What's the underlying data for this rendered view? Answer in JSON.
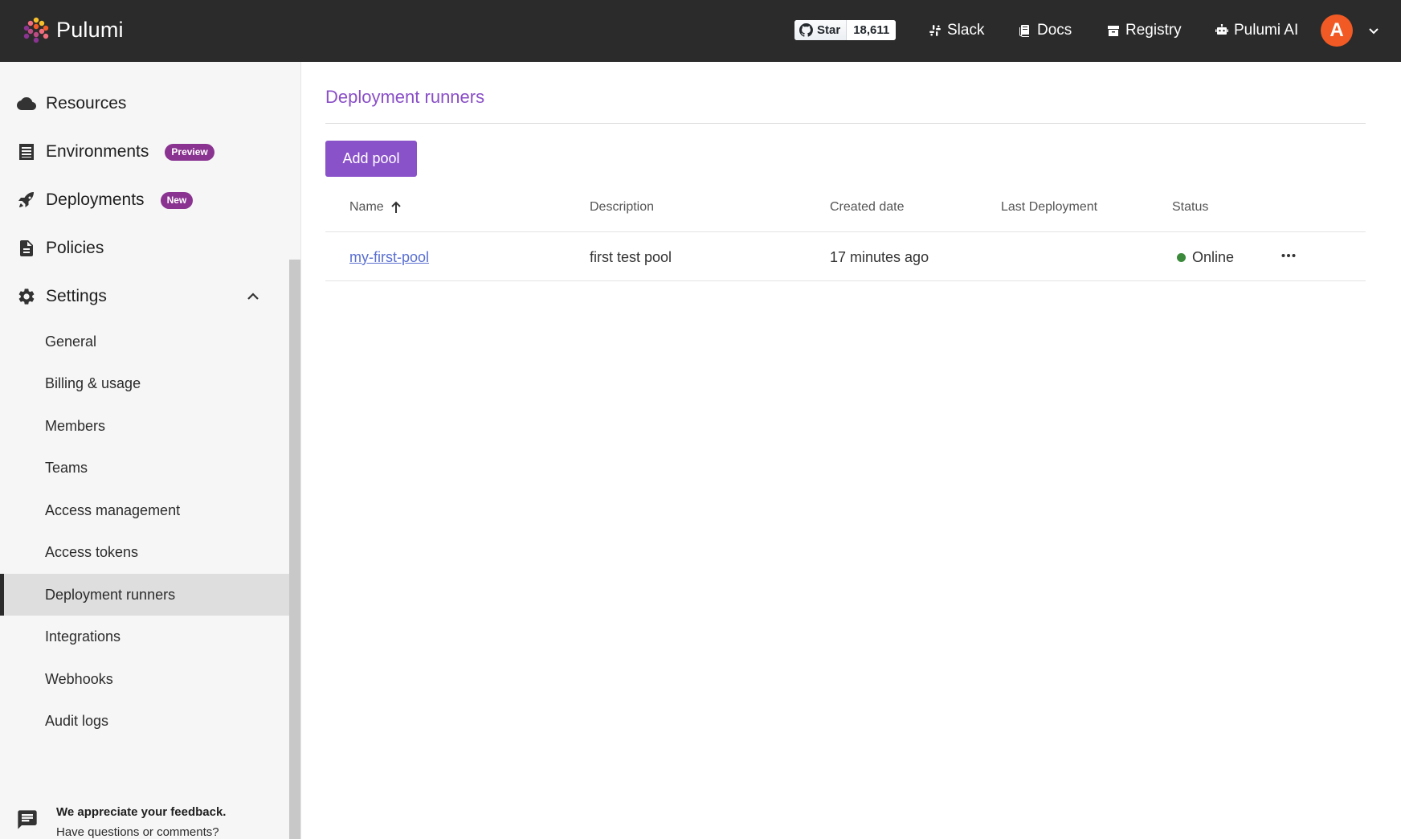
{
  "header": {
    "brand": "Pulumi",
    "github": {
      "star_label": "Star",
      "star_count": "18,611"
    },
    "links": {
      "slack": "Slack",
      "docs": "Docs",
      "registry": "Registry",
      "ai": "Pulumi AI"
    },
    "avatar_initial": "A"
  },
  "sidebar": {
    "primary": [
      {
        "label": "Resources",
        "icon": "cloud-icon"
      },
      {
        "label": "Environments",
        "icon": "list-icon",
        "badge": "Preview"
      },
      {
        "label": "Deployments",
        "icon": "rocket-icon",
        "badge": "New"
      },
      {
        "label": "Policies",
        "icon": "document-icon"
      },
      {
        "label": "Settings",
        "icon": "gear-icon"
      }
    ],
    "settings_items": [
      "General",
      "Billing & usage",
      "Members",
      "Teams",
      "Access management",
      "Access tokens",
      "Deployment runners",
      "Integrations",
      "Webhooks",
      "Audit logs"
    ],
    "active_item": "Deployment runners",
    "feedback": {
      "title": "We appreciate your feedback.",
      "subtitle": "Have questions or comments?"
    }
  },
  "main": {
    "title": "Deployment runners",
    "add_button": "Add pool",
    "columns": [
      "Name",
      "Description",
      "Created date",
      "Last Deployment",
      "Status"
    ],
    "rows": [
      {
        "name": "my-first-pool",
        "description": "first test pool",
        "created": "17 minutes ago",
        "last_deployment": "",
        "status": "Online"
      }
    ]
  },
  "colors": {
    "topbar": "#2b2b2b",
    "accent": "#8a52c9",
    "badge": "#8a3391",
    "avatar": "#f15a24",
    "online": "#3b8a3b"
  }
}
